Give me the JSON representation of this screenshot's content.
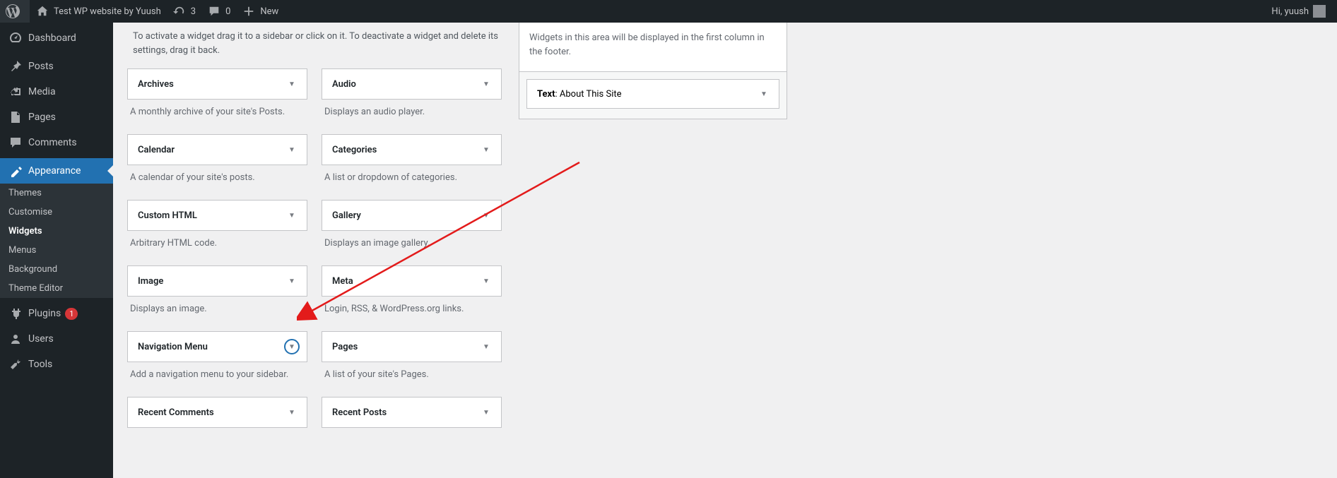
{
  "toolbar": {
    "site_title": "Test WP website by Yuush",
    "updates": "3",
    "comments": "0",
    "new_label": "New",
    "greeting": "Hi, yuush"
  },
  "sidebar": {
    "dashboard": "Dashboard",
    "posts": "Posts",
    "media": "Media",
    "pages": "Pages",
    "comments": "Comments",
    "appearance": "Appearance",
    "appearance_sub": {
      "themes": "Themes",
      "customise": "Customise",
      "widgets": "Widgets",
      "menus": "Menus",
      "background": "Background",
      "theme_editor": "Theme Editor"
    },
    "plugins": "Plugins",
    "plugins_badge": "1",
    "users": "Users",
    "tools": "Tools"
  },
  "intro": "To activate a widget drag it to a sidebar or click on it. To deactivate a widget and delete its settings, drag it back.",
  "widgets": {
    "archives": {
      "title": "Archives",
      "desc": "A monthly archive of your site's Posts."
    },
    "audio": {
      "title": "Audio",
      "desc": "Displays an audio player."
    },
    "calendar": {
      "title": "Calendar",
      "desc": "A calendar of your site's posts."
    },
    "categories": {
      "title": "Categories",
      "desc": "A list or dropdown of categories."
    },
    "custom_html": {
      "title": "Custom HTML",
      "desc": "Arbitrary HTML code."
    },
    "gallery": {
      "title": "Gallery",
      "desc": "Displays an image gallery."
    },
    "image": {
      "title": "Image",
      "desc": "Displays an image."
    },
    "meta": {
      "title": "Meta",
      "desc": "Login, RSS, & WordPress.org links."
    },
    "nav_menu": {
      "title": "Navigation Menu",
      "desc": "Add a navigation menu to your sidebar."
    },
    "pages": {
      "title": "Pages",
      "desc": "A list of your site's Pages."
    },
    "recent_comments": {
      "title": "Recent Comments"
    },
    "recent_posts": {
      "title": "Recent Posts"
    }
  },
  "area": {
    "desc": "Widgets in this area will be displayed in the first column in the footer.",
    "text_label": "Text",
    "text_title": "About This Site"
  }
}
